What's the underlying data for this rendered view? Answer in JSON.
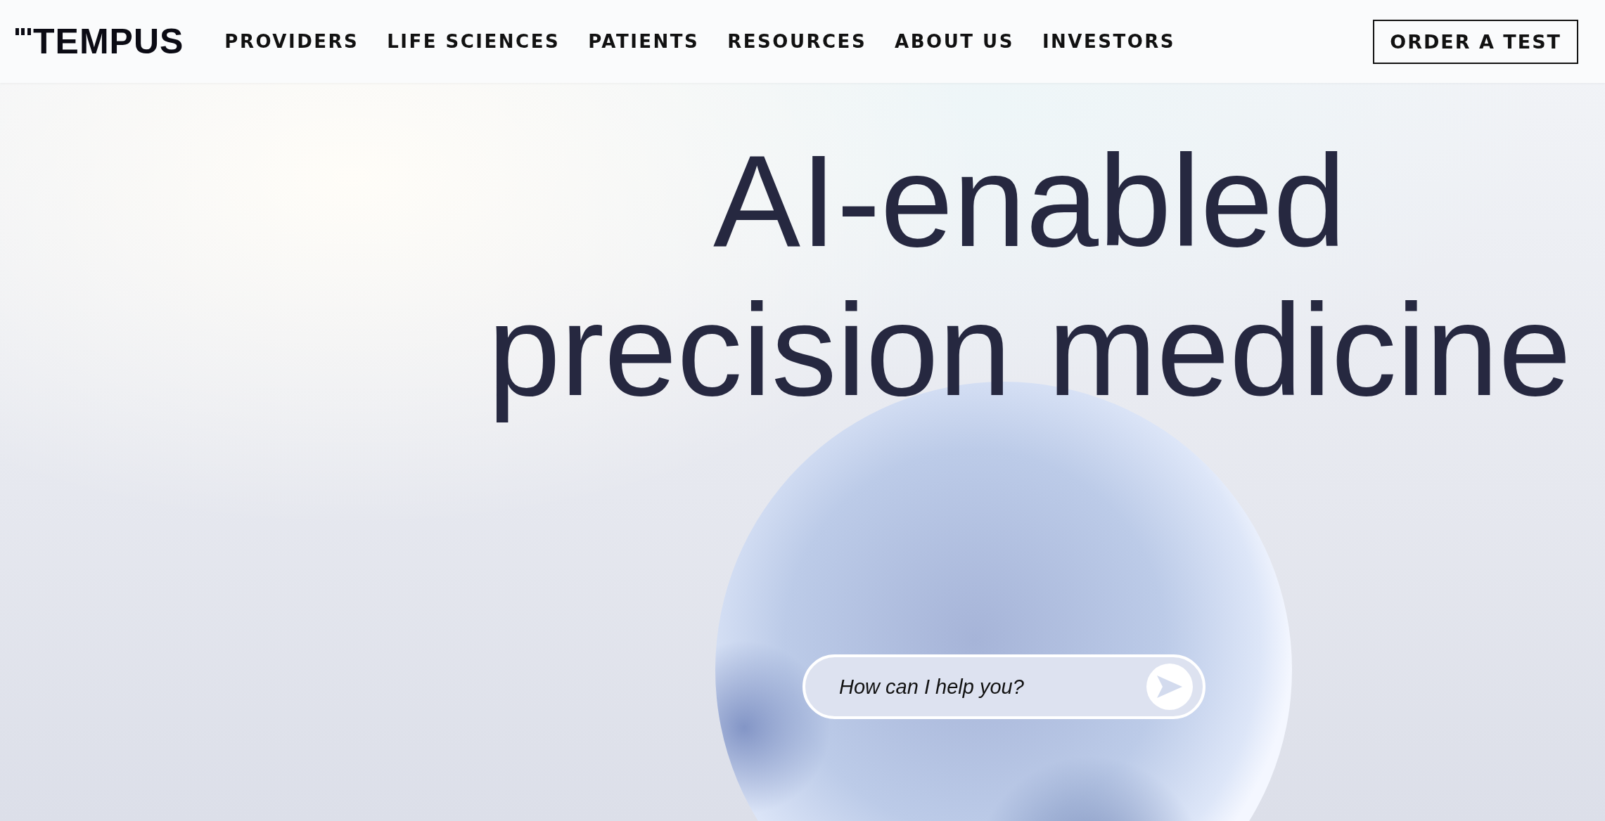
{
  "header": {
    "logo": "TEMPUS",
    "nav": [
      {
        "label": "PROVIDERS"
      },
      {
        "label": "LIFE SCIENCES"
      },
      {
        "label": "PATIENTS"
      },
      {
        "label": "RESOURCES"
      },
      {
        "label": "ABOUT US"
      },
      {
        "label": "INVESTORS"
      }
    ],
    "cta": "ORDER A TEST"
  },
  "hero": {
    "headline_lines": [
      "AI-enabled",
      "precision medicine"
    ],
    "chat": {
      "placeholder": "How can I help you?"
    }
  }
}
